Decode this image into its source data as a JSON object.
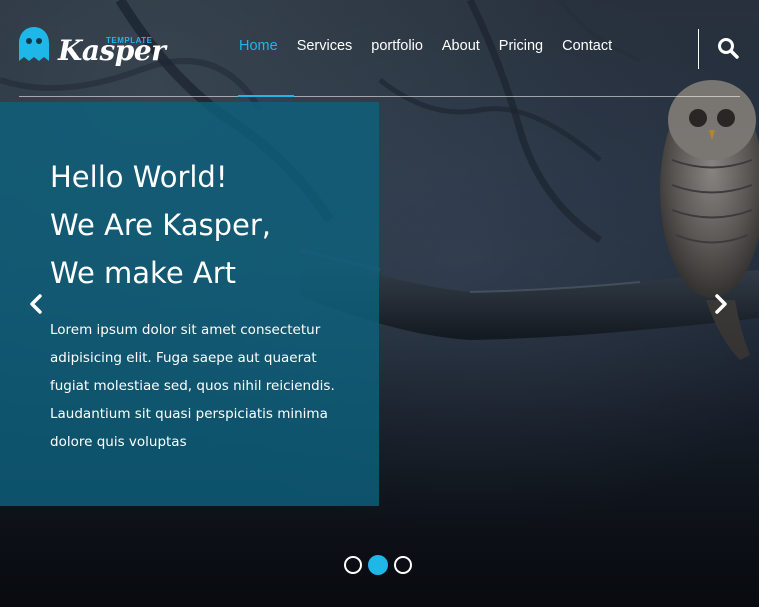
{
  "brand": {
    "name": "Kasper",
    "tag": "TEMPLATE",
    "accent_color": "#1fb6e8",
    "logo_icon": "ghost-icon"
  },
  "nav": {
    "items": [
      {
        "label": "Home",
        "active": true
      },
      {
        "label": "Services",
        "active": false
      },
      {
        "label": "portfolio",
        "active": false
      },
      {
        "label": "About",
        "active": false
      },
      {
        "label": "Pricing",
        "active": false
      },
      {
        "label": "Contact",
        "active": false
      }
    ],
    "search_icon": "search-icon"
  },
  "slide": {
    "headline": [
      "Hello World!",
      "We Are Kasper,",
      "We make Art"
    ],
    "body": [
      "Lorem ipsum dolor sit amet consectetur",
      "adipisicing elit. Fuga saepe aut quaerat",
      "fugiat molestiae sed, quos nihil reiciendis.",
      "Laudantium sit quasi perspiciatis minima",
      "dolore quis voluptas"
    ],
    "panel_color": "#0e607c",
    "prev_icon": "chevron-left-icon",
    "next_icon": "chevron-right-icon"
  },
  "slider": {
    "count": 3,
    "active_index": 1
  }
}
